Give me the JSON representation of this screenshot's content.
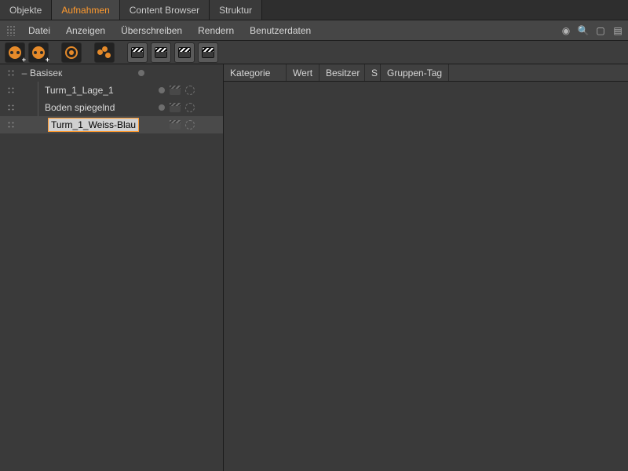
{
  "tabs": [
    "Objekte",
    "Aufnahmen",
    "Content Browser",
    "Struktur"
  ],
  "active_tab_index": 1,
  "menu": [
    "Datei",
    "Anzeigen",
    "Überschreiben",
    "Rendern",
    "Benutzerdaten"
  ],
  "toolbar_icons": [
    "reel-add-icon",
    "reel-add-alt-icon",
    "sep",
    "target-icon",
    "sep",
    "molecule-icon",
    "sep",
    "clapper-1-icon",
    "clapper-2-icon",
    "clapper-3-icon",
    "clapper-4-icon"
  ],
  "tree": [
    {
      "label": "Basis",
      "indent": 0,
      "expanded": true,
      "icons": [
        "dot"
      ]
    },
    {
      "label": "Turm_1_Lage_1",
      "indent": 1,
      "icons": [
        "dot",
        "mini-clap",
        "gear"
      ]
    },
    {
      "label": "Boden spiegelnd",
      "indent": 1,
      "icons": [
        "dot",
        "mini-clap",
        "gear"
      ]
    },
    {
      "label": "Turm_1_Weiss-Blau",
      "indent": 2,
      "editing": true,
      "selected": true,
      "icons": [
        "mini-clap",
        "gear"
      ]
    }
  ],
  "detail_columns": [
    "Kategorie",
    "Wert",
    "Besitzer",
    "S",
    "Gruppen-Tag"
  ]
}
